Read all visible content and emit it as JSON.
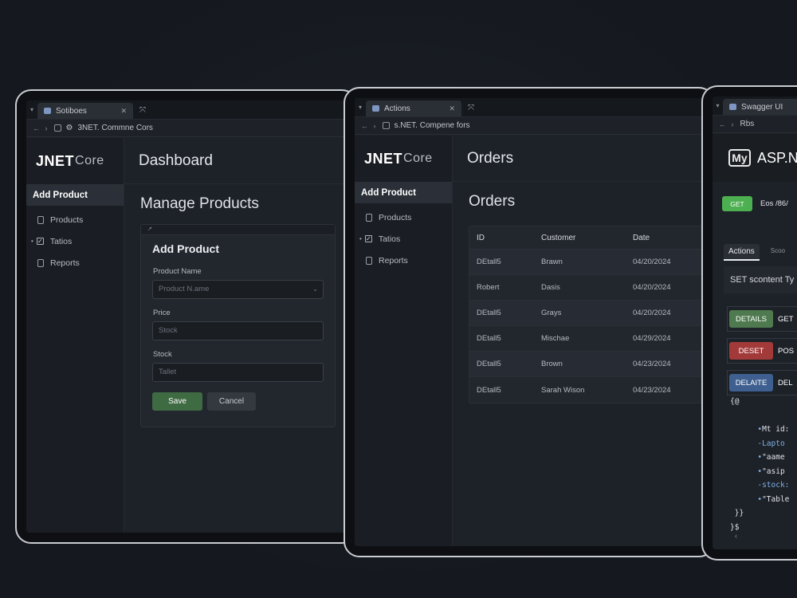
{
  "tablet1": {
    "tab": {
      "title": "Sotiboes"
    },
    "address": "3NET. Commne Cors",
    "logo": {
      "main": "JNET",
      "sub": "Core"
    },
    "sidebar": [
      {
        "label": "Add Product"
      },
      {
        "label": "Products"
      },
      {
        "label": "Tatios"
      },
      {
        "label": "Reports"
      }
    ],
    "topbar_title": "Dashboard",
    "section_title": "Manage Products",
    "form": {
      "strip_mark": "↗",
      "title": "Add Product",
      "product_name_label": "Product Name",
      "product_name_placeholder": "Product N.ame",
      "price_label": "Price",
      "price_placeholder": "Stock",
      "stock_label": "Stock",
      "stock_placeholder": "Tallet",
      "save_label": "Save",
      "cancel_label": "Cancel"
    }
  },
  "tablet2": {
    "tab": {
      "title": "Actions"
    },
    "address": "s.NET. Compene fors",
    "logo": {
      "main": "JNET",
      "sub": "Core"
    },
    "sidebar": [
      {
        "label": "Add Product"
      },
      {
        "label": "Products"
      },
      {
        "label": "Tatios"
      },
      {
        "label": "Reports"
      }
    ],
    "topbar_title": "Orders",
    "section_title": "Orders",
    "table": {
      "columns": [
        "ID",
        "Customer",
        "Date"
      ],
      "rows": [
        [
          "DEtall5",
          "Brawn",
          "04/20/2024"
        ],
        [
          "Robert",
          "Dasis",
          "04/20/2024"
        ],
        [
          "DEtall5",
          "Grays",
          "04/20/2024"
        ],
        [
          "DEtall5",
          "Mischae",
          "04/29/2024"
        ],
        [
          "DEtall5",
          "Brown",
          "04/23/2024"
        ],
        [
          "DEtall5",
          "Sarah Wison",
          "04/23/2024"
        ]
      ]
    }
  },
  "tablet3": {
    "tab": {
      "title": "Swagger UI"
    },
    "address": "Rbs",
    "logo": "My",
    "title": "ASP.N",
    "get_badge": "GET",
    "path": "Eos /86/",
    "tabs": [
      "Actions",
      "Scoo"
    ],
    "content_line": "SET scontent Ty",
    "operations": [
      {
        "badge": "DETAILS",
        "verb": "GET",
        "color": "#4f7a4f"
      },
      {
        "badge": "DESET",
        "verb": "POS",
        "color": "#a33a3a"
      },
      {
        "badge": "DELAITE",
        "verb": "DEL",
        "color": "#3e5f8f"
      }
    ],
    "code": {
      "open": "{@",
      "line1": "Mt id:",
      "line2": "Lapto",
      "line3": "\"aame",
      "line4": "\"asip",
      "line5": "stock:",
      "line6": "\"Table",
      "close1": "}}",
      "close2": "}$"
    }
  },
  "colors": {
    "save": "#3f6b43",
    "get": "#4caf50",
    "background": "#161a21"
  }
}
